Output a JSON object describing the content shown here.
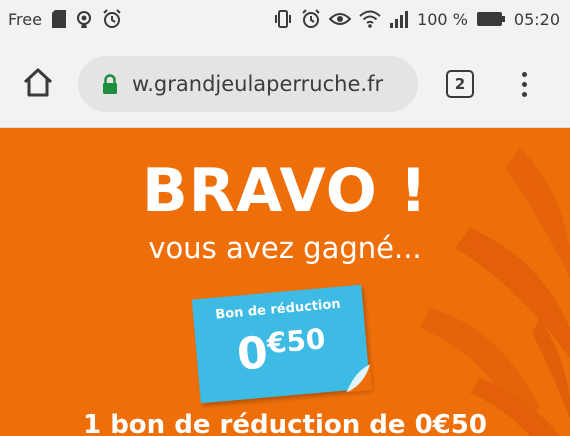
{
  "status_bar": {
    "carrier": "Free",
    "battery": "100 %",
    "time": "05:20",
    "icons": [
      "sd-card-icon",
      "hotspot-icon",
      "alarm-icon",
      "vibrate-icon",
      "alarm-icon",
      "eye-icon",
      "wifi-icon",
      "signal-icon",
      "battery-icon"
    ]
  },
  "toolbar": {
    "url": "w.grandjeulaperruche.fr",
    "tab_count": "2",
    "lock_color": "#1e8e3e"
  },
  "page": {
    "headline": "BRAVO !",
    "subline": "vous avez gagné...",
    "coupon_label": "Bon de réduction",
    "coupon_value_big": "0",
    "coupon_value_small": "€50",
    "bottom_text": "1 bon de réduction de 0€50",
    "colors": {
      "background": "#ee6f0a",
      "coupon": "#3ebbe4",
      "text": "#ffffff"
    }
  }
}
